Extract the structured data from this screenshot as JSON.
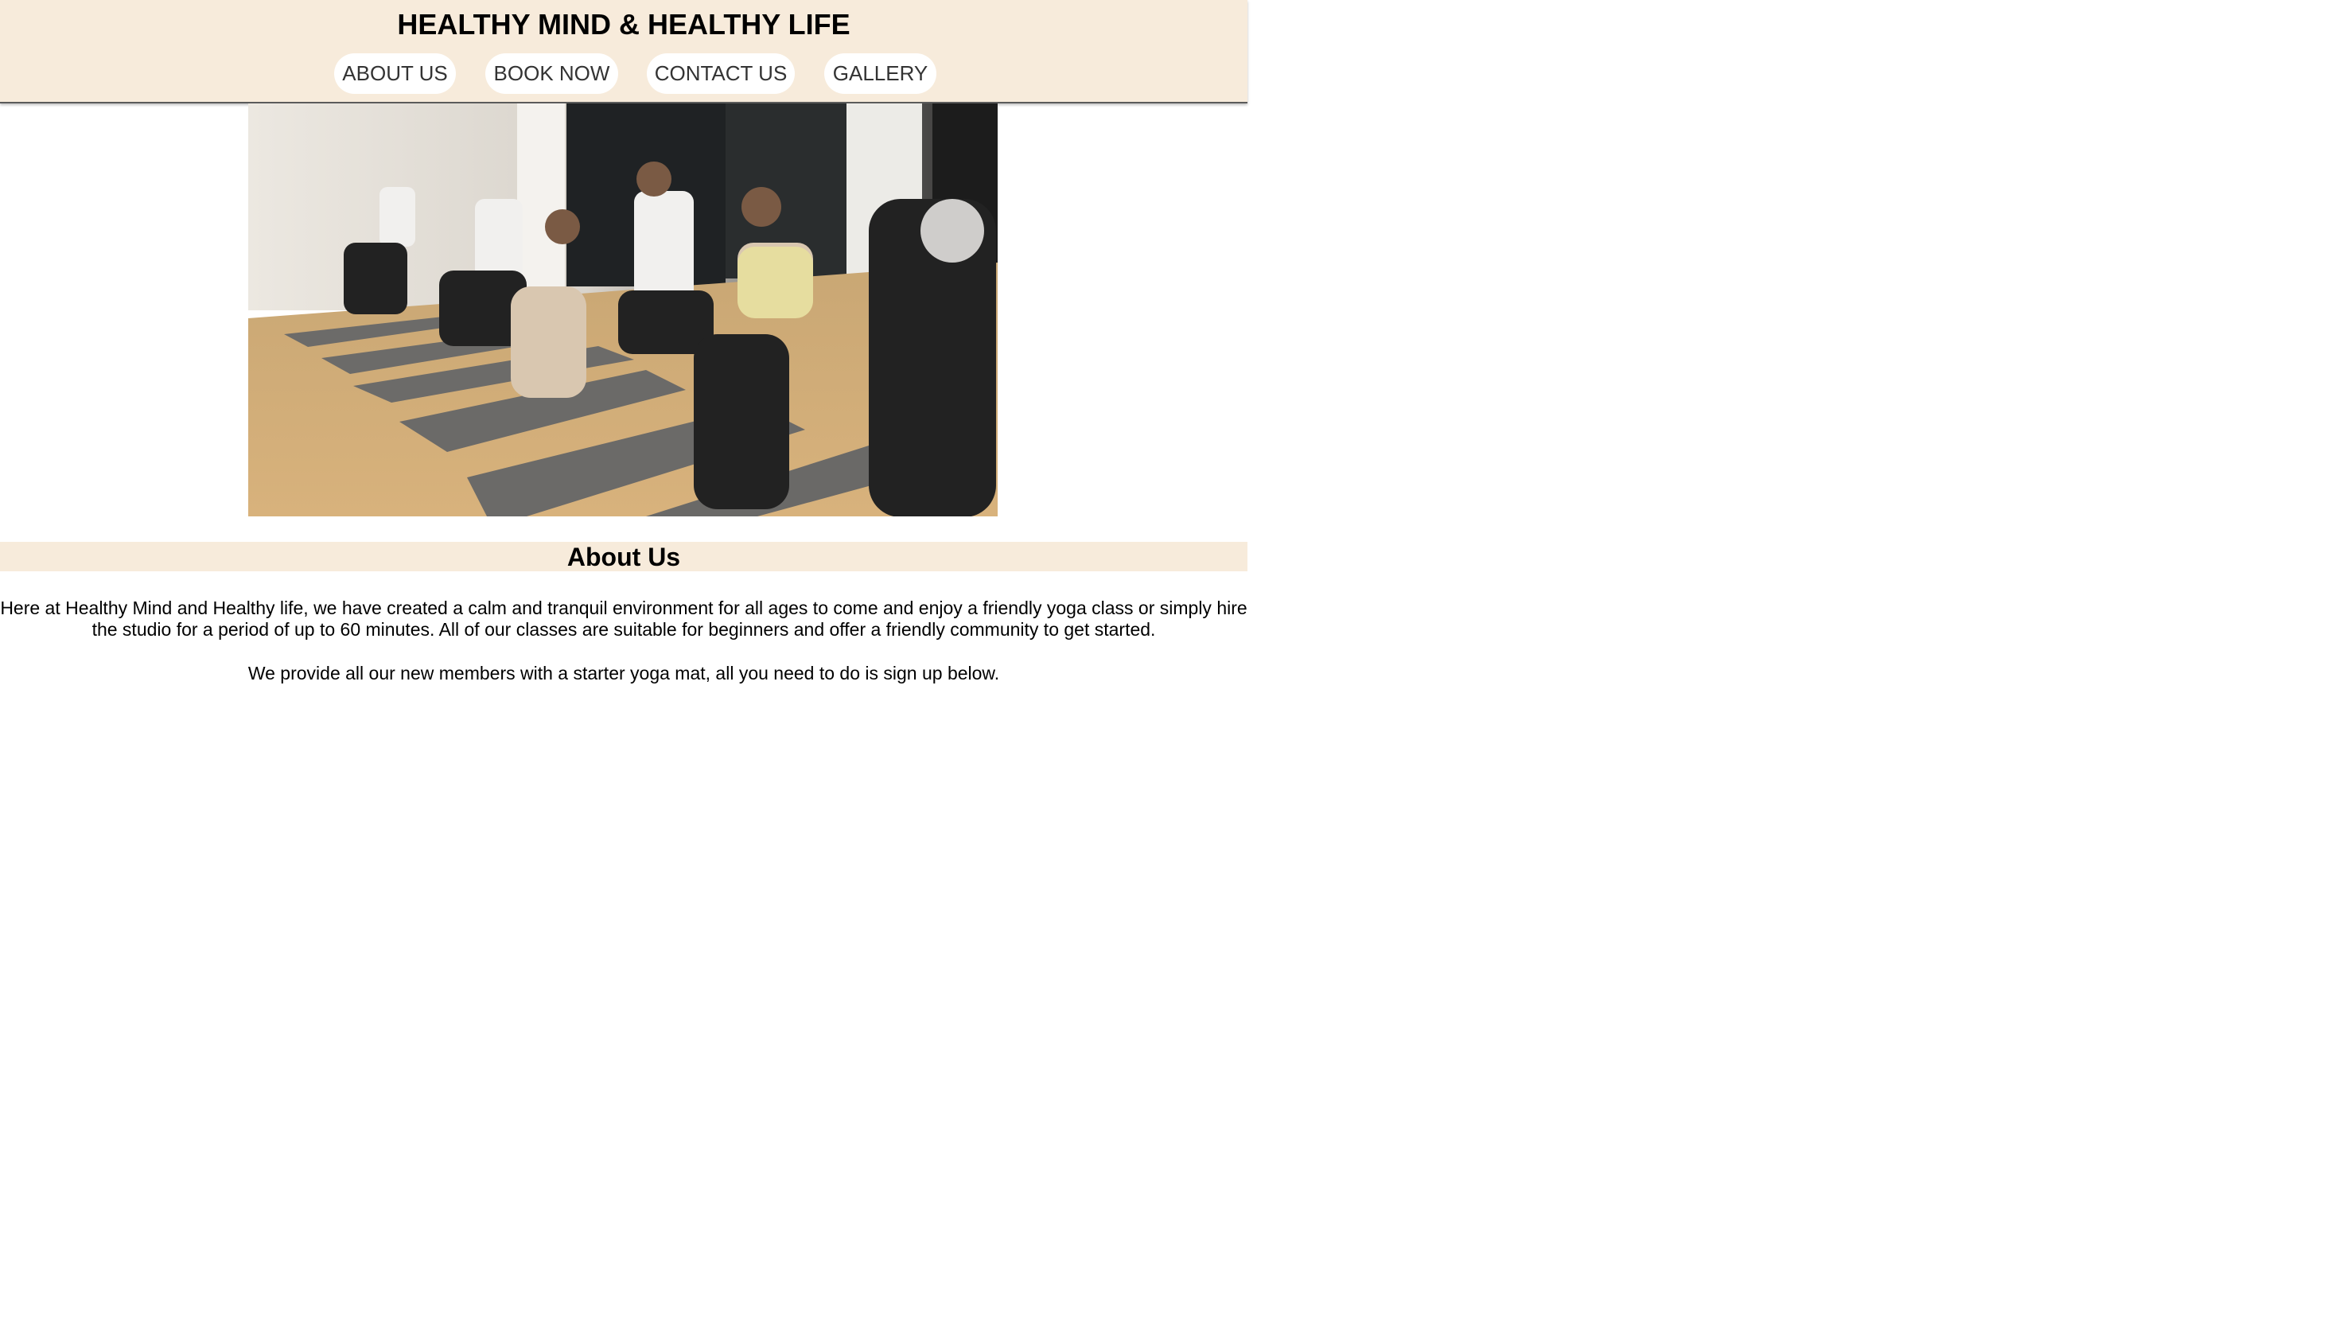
{
  "header": {
    "title": "HEALTHY MIND & HEALTHY LIFE",
    "background": "#f7ebdb"
  },
  "nav": {
    "items": [
      {
        "label": "ABOUT US"
      },
      {
        "label": "BOOK NOW"
      },
      {
        "label": "CONTACT US"
      },
      {
        "label": "GALLERY"
      }
    ]
  },
  "hero": {
    "description": "yoga-class-photo"
  },
  "about": {
    "heading": "About Us",
    "paragraph1": "Here at Healthy Mind and Healthy life, we have created a calm and tranquil environment for all ages to come and enjoy a friendly yoga class or simply hire the studio for a period of up to 60 minutes. All of our classes are suitable for beginners and offer a friendly community to get started.",
    "paragraph2": "We provide all our new members with a starter yoga mat, all you need to do is sign up below."
  }
}
